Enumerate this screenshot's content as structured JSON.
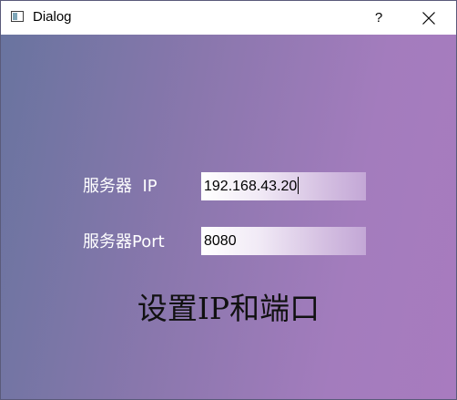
{
  "window": {
    "title": "Dialog",
    "help_label": "?",
    "close_icon": "close-icon"
  },
  "form": {
    "ip_label": "服务器  IP",
    "ip_value": "192.168.43.20",
    "port_label": "服务器Port",
    "port_value": "8080"
  },
  "action": {
    "set_button_label": "设置IP和端口"
  },
  "colors": {
    "gradient_start": "#69749f",
    "gradient_end": "#a87bbf",
    "label_text": "#ffffff"
  }
}
